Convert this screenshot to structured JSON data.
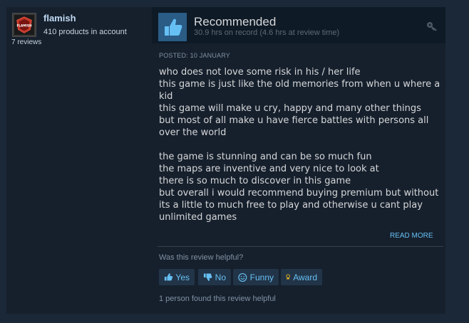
{
  "author": {
    "name": "flamish",
    "products": "410 products in account",
    "reviews": "7 reviews",
    "avatar_text": "FLAMISH"
  },
  "review": {
    "verdict": "Recommended",
    "hours": "30.9 hrs on record (4.6 hrs at review time)",
    "posted": "POSTED: 10 JANUARY",
    "paragraphs": [
      "who does not love some risk in his / her life\nthis game is just like the old memories from when u where a kid\nthis game will make u cry, happy and many other things\nbut most of all make u have fierce battles with persons all over the world",
      "the game is stunning and can be so much fun\nthe maps are inventive and very nice to look at\nthere is so much to discover in this game\nbut overall i would recommend buying premium but without its a little to much free to play and otherwise u cant play unlimited games"
    ],
    "read_more": "READ MORE"
  },
  "helpful": {
    "question": "Was this review helpful?",
    "yes_label": "Yes",
    "no_label": "No",
    "funny_label": "Funny",
    "award_label": "Award",
    "summary": "1 person found this review helpful"
  },
  "icons": {
    "verdict": "thumbs-up-icon",
    "menu": "key-icon",
    "yes": "thumbs-up-icon",
    "no": "thumbs-down-icon",
    "funny": "smiley-icon",
    "award": "award-icon"
  },
  "colors": {
    "background": "#1b2838",
    "card": "#16202d",
    "accent": "#66c0f4",
    "thumb_box": "#2a5c86",
    "award": "#e8b81e"
  }
}
